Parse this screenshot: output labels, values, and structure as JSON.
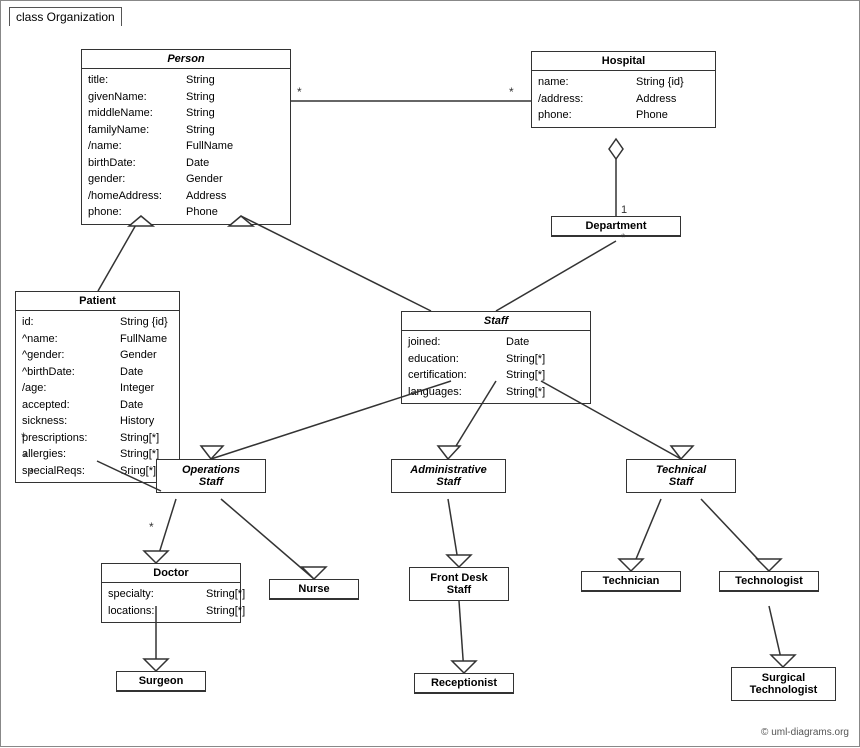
{
  "diagram": {
    "title": "class Organization",
    "copyright": "© uml-diagrams.org",
    "classes": {
      "person": {
        "name": "Person",
        "italic": true,
        "attrs": [
          {
            "name": "title:",
            "type": "String"
          },
          {
            "name": "givenName:",
            "type": "String"
          },
          {
            "name": "middleName:",
            "type": "String"
          },
          {
            "name": "familyName:",
            "type": "String"
          },
          {
            "name": "/name:",
            "type": "FullName"
          },
          {
            "name": "birthDate:",
            "type": "Date"
          },
          {
            "name": "gender:",
            "type": "Gender"
          },
          {
            "name": "/homeAddress:",
            "type": "Address"
          },
          {
            "name": "phone:",
            "type": "Phone"
          }
        ]
      },
      "hospital": {
        "name": "Hospital",
        "italic": false,
        "attrs": [
          {
            "name": "name:",
            "type": "String {id}"
          },
          {
            "name": "/address:",
            "type": "Address"
          },
          {
            "name": "phone:",
            "type": "Phone"
          }
        ]
      },
      "department": {
        "name": "Department",
        "italic": false,
        "attrs": []
      },
      "staff": {
        "name": "Staff",
        "italic": true,
        "attrs": [
          {
            "name": "joined:",
            "type": "Date"
          },
          {
            "name": "education:",
            "type": "String[*]"
          },
          {
            "name": "certification:",
            "type": "String[*]"
          },
          {
            "name": "languages:",
            "type": "String[*]"
          }
        ]
      },
      "patient": {
        "name": "Patient",
        "italic": false,
        "attrs": [
          {
            "name": "id:",
            "type": "String {id}"
          },
          {
            "name": "^name:",
            "type": "FullName"
          },
          {
            "name": "^gender:",
            "type": "Gender"
          },
          {
            "name": "^birthDate:",
            "type": "Date"
          },
          {
            "name": "/age:",
            "type": "Integer"
          },
          {
            "name": "accepted:",
            "type": "Date"
          },
          {
            "name": "sickness:",
            "type": "History"
          },
          {
            "name": "prescriptions:",
            "type": "String[*]"
          },
          {
            "name": "allergies:",
            "type": "String[*]"
          },
          {
            "name": "specialReqs:",
            "type": "Sring[*]"
          }
        ]
      },
      "operations_staff": {
        "name": "Operations Staff",
        "italic": true
      },
      "administrative_staff": {
        "name": "Administrative Staff",
        "italic": true
      },
      "technical_staff": {
        "name": "Technical Staff",
        "italic": true
      },
      "doctor": {
        "name": "Doctor",
        "italic": false,
        "attrs": [
          {
            "name": "specialty:",
            "type": "String[*]"
          },
          {
            "name": "locations:",
            "type": "String[*]"
          }
        ]
      },
      "nurse": {
        "name": "Nurse",
        "italic": false,
        "attrs": []
      },
      "front_desk_staff": {
        "name": "Front Desk Staff",
        "italic": false,
        "attrs": []
      },
      "technician": {
        "name": "Technician",
        "italic": false,
        "attrs": []
      },
      "technologist": {
        "name": "Technologist",
        "italic": false,
        "attrs": []
      },
      "surgeon": {
        "name": "Surgeon",
        "italic": false,
        "attrs": []
      },
      "receptionist": {
        "name": "Receptionist",
        "italic": false,
        "attrs": []
      },
      "surgical_technologist": {
        "name": "Surgical Technologist",
        "italic": false,
        "attrs": []
      }
    }
  }
}
